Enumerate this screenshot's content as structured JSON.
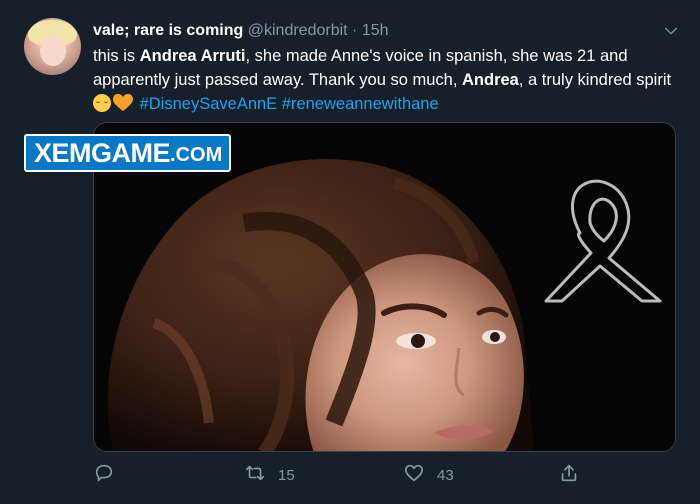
{
  "tweet": {
    "display_name": "vale; rare is coming",
    "handle": "@kindredorbit",
    "separator": "·",
    "time": "15h",
    "text": {
      "p1": "this is ",
      "b1": "Andrea Arruti",
      "p2": ", she made Anne's voice in spanish, she was 21 and apparently just passed away. Thank you so much, ",
      "b2": "Andrea",
      "p3": ", a truly kindred spirit ",
      "hashtag1": "#DisneySaveAnnE",
      "hashtag2": "#reneweannewithane"
    },
    "emojis": [
      "relieved-face",
      "yellow-heart"
    ]
  },
  "watermark": {
    "main": "XEMGAME",
    "suffix": ".COM"
  },
  "actions": {
    "reply_count": "",
    "retweet_count": "15",
    "like_count": "43"
  },
  "icons": {
    "caret": "chevron-down-icon",
    "reply": "reply-icon",
    "retweet": "retweet-icon",
    "like": "heart-icon",
    "share": "share-icon"
  },
  "colors": {
    "background": "#15202b",
    "text": "#ffffff",
    "muted": "#8899a6",
    "link": "#1da1f2",
    "watermark_blue": "#0a78c4"
  }
}
